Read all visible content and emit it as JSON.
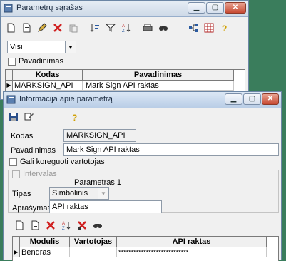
{
  "back_window": {
    "title": "Parametrų sąrašas",
    "filter": {
      "value": "Visi"
    },
    "pavadinimas_checkbox_label": "Pavadinimas",
    "columns": [
      "Kodas",
      "Pavadinimas"
    ],
    "rows": [
      {
        "kodas": "MARKSIGN_API",
        "pavadinimas": "Mark Sign API raktas"
      }
    ],
    "toolbar_icons": [
      "new-icon",
      "copy-doc-icon",
      "edit-icon",
      "delete-icon",
      "paste-icon",
      "sort-icon",
      "filter-icon",
      "sort-az-icon",
      "print-icon",
      "find-icon",
      "tree-icon",
      "grid-icon",
      "help-icon"
    ]
  },
  "front_window": {
    "title": "Informacija apie parametrą",
    "toolbar_icons": [
      "save-icon",
      "properties-icon",
      "help-icon"
    ],
    "kodas_label": "Kodas",
    "kodas_value": "MARKSIGN_API",
    "pavadinimas_label": "Pavadinimas",
    "pavadinimas_value": "Mark Sign API raktas",
    "gali_koreguoti_label": "Gali koreguoti vartotojas",
    "intervalas_label": "Intervalas",
    "group_title": "Parametras 1",
    "tipas_label": "Tipas",
    "tipas_value": "Simbolinis",
    "aprasymas_label": "Aprašymas",
    "aprasymas_value": "API raktas",
    "grid_toolbar_icons": [
      "new-icon",
      "copy-doc-icon",
      "delete-icon",
      "sort-az-icon",
      "delete-all-icon",
      "find-icon"
    ],
    "columns": [
      "Modulis",
      "Vartotojas",
      "API raktas"
    ],
    "rows": [
      {
        "modulis": "Bendras",
        "vartotojas": "",
        "api_raktas": "****************************"
      }
    ]
  },
  "colors": {
    "desktop": "#3a7d5c",
    "close_button": "#c74a33",
    "title_gradient_top": "#dbe7f5"
  }
}
